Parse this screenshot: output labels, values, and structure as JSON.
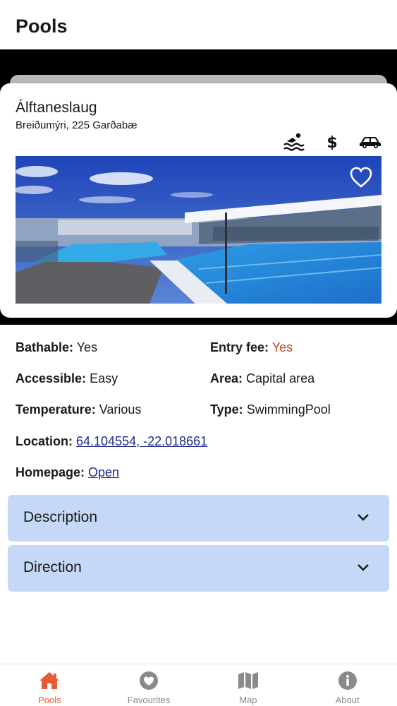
{
  "header": {
    "title": "Pools"
  },
  "card": {
    "name": "Álftaneslaug",
    "address": "Breiðumýri, 225 Garðabæ",
    "amenity_icons": [
      "swimmer-icon",
      "dollar-icon",
      "car-icon"
    ],
    "favourite_icon": "heart-outline-icon"
  },
  "details": {
    "bathable_label": "Bathable:",
    "bathable_value": "Yes",
    "entry_fee_label": "Entry fee:",
    "entry_fee_value": "Yes",
    "accessible_label": "Accessible:",
    "accessible_value": "Easy",
    "area_label": "Area:",
    "area_value": "Capital area",
    "temperature_label": "Temperature:",
    "temperature_value": "Various",
    "type_label": "Type:",
    "type_value": "SwimmingPool",
    "location_label": "Location:",
    "location_value": "64.104554, -22.018661",
    "homepage_label": "Homepage:",
    "homepage_value": "Open"
  },
  "accordions": [
    {
      "label": "Description"
    },
    {
      "label": "Direction"
    }
  ],
  "tabs": [
    {
      "label": "Pools",
      "icon": "home-icon",
      "active": true
    },
    {
      "label": "Favourites",
      "icon": "heart-icon",
      "active": false
    },
    {
      "label": "Map",
      "icon": "map-icon",
      "active": false
    },
    {
      "label": "About",
      "icon": "info-icon",
      "active": false
    }
  ],
  "colors": {
    "accent": "#e45b3a",
    "link": "#1f2a8a",
    "warn": "#b44a2a",
    "accordion_bg": "#c6d8f7",
    "tab_inactive": "#8a8a8a"
  }
}
